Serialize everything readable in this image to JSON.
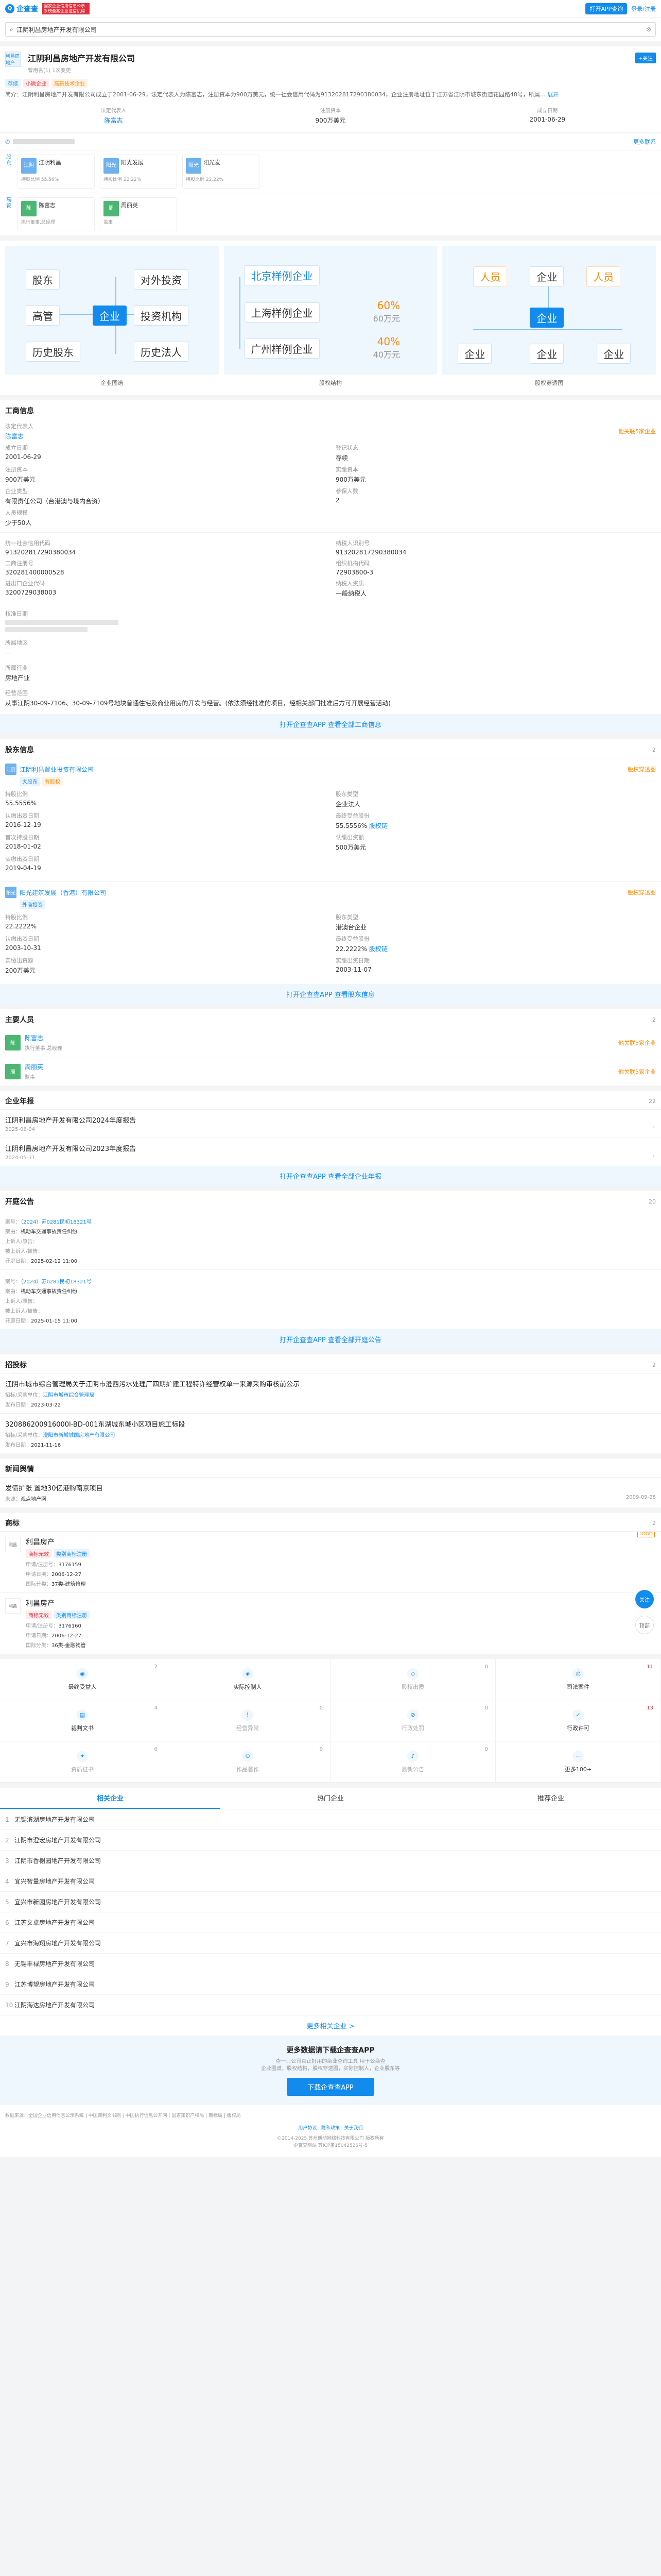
{
  "topbar": {
    "logo": "企查查",
    "promo": "国家企业信用信息公示系统备案企业征信机构",
    "app_btn": "打开APP查询",
    "login": "登录/注册"
  },
  "search": {
    "value": "江阴利昌房地产开发有限公司"
  },
  "company": {
    "logo_text": "利昌房地产",
    "name": "江阴利昌房地产开发有限公司",
    "sub": "曾用名(1) 1次变更",
    "follow": "+关注",
    "tags": [
      "存续",
      "小微企业",
      "高新技术企业"
    ],
    "intro": "简介：江阴利昌房地产开发有限公司成立于2001-06-29，法定代表人为陈富志，注册资本为900万美元，统一社会信用代码为913202817290380034，企业注册地址位于江苏省江阴市城东街道花园路48号，所属…",
    "intro_more": "展开",
    "legal_label": "法定代表人",
    "legal": "陈富志",
    "capital_label": "注册资本",
    "capital": "900万美元",
    "date_label": "成立日期",
    "date": "2001-06-29"
  },
  "contact": {
    "more": "更多联系"
  },
  "relations": {
    "shareholder_label": "股东",
    "people_label": "高管",
    "items": [
      {
        "av": "江阴",
        "name": "江阴利昌",
        "role": "持股比例 55.56%"
      },
      {
        "av": "阳光",
        "name": "阳光发展",
        "role": "持股比例 22.22%"
      },
      {
        "av": "阳光",
        "name": "阳光发",
        "role": "持股比例 22.22%"
      }
    ],
    "people": [
      {
        "av": "陈",
        "name": "陈富志",
        "role": "执行董事,总经理"
      },
      {
        "av": "周",
        "name": "周丽英",
        "role": "监事"
      }
    ]
  },
  "graphs": {
    "g1": {
      "title": "企业图谱",
      "words": [
        "股东",
        "对外投资",
        "高管",
        "企业",
        "投资机构",
        "历史股东",
        "历史法人"
      ]
    },
    "g2": {
      "title": "股权结构",
      "words": [
        "北京样例企业",
        "上海样例企业",
        "广州样例企业"
      ],
      "pct": [
        "60%",
        "40%"
      ],
      "amt": [
        "60万元",
        "40万元"
      ]
    },
    "g3": {
      "title": "股权穿透图",
      "words": [
        "人员",
        "企业",
        "人员",
        "企业",
        "企业",
        "企业",
        "企业"
      ]
    }
  },
  "business": {
    "title": "工商信息",
    "legal_k": "法定代表人",
    "legal_v": "陈富志",
    "legal_r": "他关联5家企业",
    "status_k": "登记状态",
    "status_v": "存续",
    "est_k": "成立日期",
    "est_v": "2001-06-29",
    "reg_cap_k": "注册资本",
    "reg_cap_v": "900万美元",
    "paid_k": "实缴资本",
    "paid_v": "900万美元",
    "type_k": "企业类型",
    "type_v": "有限责任公司（台港澳与境内合资）",
    "size_k": "参保人数",
    "size_v": "2",
    "scale_k": "人员规模",
    "scale_v": "少于50人",
    "credit_k": "统一社会信用代码",
    "credit_v": "913202817290380034",
    "tax_k": "纳税人识别号",
    "tax_v": "913202817290380034",
    "reg_k": "工商注册号",
    "reg_v": "320281400000528",
    "org_k": "组织机构代码",
    "org_v": "72903800-3",
    "imp_k": "进出口企业代码",
    "imp_v": "3200729038003",
    "tax_q_k": "纳税人资质",
    "tax_q_v": "一般纳税人",
    "approve_k": "核准日期",
    "area_k": "所属地区",
    "area_v": "—",
    "industry_k": "所属行业",
    "industry_v": "房地产业",
    "scope_k": "经营范围",
    "scope_v": "从事江阴30-09-7106、30-09-7109号地块普通住宅及商业用房的开发与经营。(依法须经批准的项目，经相关部门批准后方可开展经营活动)",
    "banner": "打开企查查APP 查看全部工商信息"
  },
  "shareholders": {
    "title": "股东信息",
    "count": "2",
    "items": [
      {
        "av": "江阴",
        "name": "江阴利昌置业投资有限公司",
        "tags": [
          "大股东",
          "有股权"
        ],
        "path": "股权穿透图",
        "k1": "持股比例",
        "v1": "55.5556%",
        "k1b": "股东类型",
        "v1b": "企业法人",
        "k2": "认缴出资日期",
        "v2": "2016-12-19",
        "k3": "最终受益股份",
        "v3": "55.5556%",
        "v3link": "股权链",
        "k4": "首次持股日期",
        "v4": "2018-01-02",
        "k5": "认缴出资额",
        "v5": "500万美元",
        "k6": "实缴出资日期",
        "v6": "2019-04-19"
      },
      {
        "av": "阳光",
        "name": "阳光建筑发展（香港）有限公司",
        "tags": [
          "外商投资"
        ],
        "path": "股权穿透图",
        "k1": "持股比例",
        "v1": "22.2222%",
        "k1b": "股东类型",
        "v1b": "港澳台企业",
        "k2": "认缴出资日期",
        "v2": "2003-10-31",
        "k3": "最终受益股份",
        "v3": "22.2222%",
        "v3link": "股权链",
        "k4": "实缴出资额",
        "v4": "200万美元",
        "k5": "实缴出资日期",
        "v5": "2003-11-07"
      }
    ],
    "banner": "打开企查查APP 查看股东信息"
  },
  "staff": {
    "title": "主要人员",
    "count": "2",
    "items": [
      {
        "av": "陈",
        "name": "陈富志",
        "role": "执行董事,总经理",
        "r": "他关联5家企业"
      },
      {
        "av": "周",
        "name": "周丽英",
        "role": "监事",
        "r": "他关联5家企业"
      }
    ]
  },
  "reports": {
    "title": "企业年报",
    "count": "22",
    "items": [
      {
        "t": "江阴利昌房地产开发有限公司2024年度报告",
        "d": "2025-06-04"
      },
      {
        "t": "江阴利昌房地产开发有限公司2023年度报告",
        "d": "2024-05-31"
      }
    ],
    "banner": "打开企查查APP 查看全部企业年报"
  },
  "court": {
    "title": "开庭公告",
    "count": "20",
    "items": [
      {
        "case": "（2024）苏0281民初18321号",
        "reason_k": "案由：",
        "reason": "机动车交通事故责任纠纷",
        "p1": "上诉人/原告：",
        "p2": "被上诉人/被告：",
        "date_k": "开庭日期：",
        "date": "2025-02-12 11:00"
      },
      {
        "case": "（2024）苏0281民初18321号",
        "reason_k": "案由：",
        "reason": "机动车交通事故责任纠纷",
        "p1": "上诉人/原告：",
        "p2": "被上诉人/被告：",
        "date_k": "开庭日期：",
        "date": "2025-01-15 11:00"
      }
    ],
    "banner": "打开企查查APP 查看全部开庭公告"
  },
  "bids": {
    "title": "招投标",
    "count": "2",
    "items": [
      {
        "t": "江阴市城市综合管理局关于江阴市澄西污水处理厂四期扩建工程特许经营权单一来源采购审核前公示",
        "k": "招标/采购单位：",
        "v": "江阴市城市综合管理局",
        "date_k": "发布日期：",
        "date": "2023-03-22"
      },
      {
        "t": "320886200916000l-BD-001东湖城东城小区项目施工标段",
        "k": "招标/采购单位：",
        "v": "澄阳市新城城国房地产有限公司",
        "date_k": "发布日期：",
        "date": "2021-11-16"
      }
    ]
  },
  "news": {
    "title": "新闻舆情",
    "item": "发债扩张 置地30亿港购南京项目",
    "src_k": "来源：",
    "src": "观点地产网",
    "date": "2009-09-28"
  },
  "trademarks": {
    "title": "商标",
    "count": "2",
    "badge": "LOGO",
    "items": [
      {
        "img": "利昌",
        "name": "利昌房产",
        "tags": [
          "商标无效",
          "类别商标注册"
        ],
        "k1": "申请/注册号：",
        "v1": "3176159",
        "k2": "申请日期：",
        "v2": "2006-12-27",
        "k3": "国际分类：",
        "v3": "37类-建筑修理"
      },
      {
        "img": "利昌",
        "name": "利昌房产",
        "tags": [
          "商标无效",
          "类别商标注册"
        ],
        "k1": "申请/注册号：",
        "v1": "3176160",
        "k2": "申请日期：",
        "v2": "2006-12-27",
        "k3": "国际分类：",
        "v3": "36类-金融物管"
      }
    ]
  },
  "grid": [
    {
      "label": "最终受益人",
      "n": "2"
    },
    {
      "label": "实际控制人",
      "n": ""
    },
    {
      "label": "股权出质",
      "n": "0"
    },
    {
      "label": "司法案件",
      "n": "11"
    },
    {
      "label": "裁判文书",
      "n": "4"
    },
    {
      "label": "经营异常",
      "n": "0"
    },
    {
      "label": "行政处罚",
      "n": "0"
    },
    {
      "label": "行政许可",
      "n": "13"
    },
    {
      "label": "资质证书",
      "n": "0"
    },
    {
      "label": "作品著作",
      "n": "0"
    },
    {
      "label": "最新公告",
      "n": "0"
    },
    {
      "label": "更多100+",
      "n": ""
    }
  ],
  "floating": {
    "follow": "关注",
    "top": "顶部"
  },
  "tabs": [
    "相关企业",
    "热门企业",
    "推荐企业"
  ],
  "related": [
    "无锡滨湖房地产开发有限公司",
    "江阴市澄宏房地产开发有限公司",
    "江阴市香榭园地产开发有限公司",
    "宜兴智量房地产开发有限公司",
    "宜兴市新园房地产开发有限公司",
    "江苏文卓房地产开发有限公司",
    "宜兴市海翔房地产开发有限公司",
    "无锡丰禄房地产开发有限公司",
    "江苏博望房地产开发有限公司",
    "江阴海达房地产开发有限公司"
  ],
  "related_more": "更多相关企业 >",
  "app_promo": {
    "title": "更多数据请下载企查查APP",
    "sub1": "查一只公司真正好用的商业查询工具 用于公商查",
    "sub2": "企业图谱，股权结构，股权穿透图，实际控制人，企业股东等",
    "btn": "下载企查查APP"
  },
  "footer": {
    "text": "数据来源：全国企业信用信息公示系统 | 中国裁判文书网 | 中国执行信息公开网 | 国家知识产权局 | 商标局 | 版权局",
    "links": "用户协议 · 隐私政策 · 关于我们",
    "cp1": "©2014-2025 苏州朗动网络科技有限公司 版权所有",
    "cp2": "企查查网站 苏ICP备15042526号-5"
  }
}
